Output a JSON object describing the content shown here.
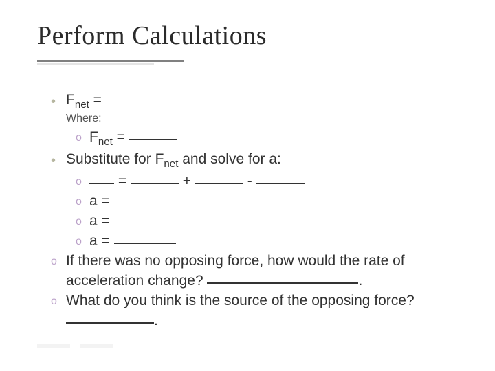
{
  "title": "Perform Calculations",
  "b1": {
    "fvar": "F",
    "fsub": "net",
    "eq": " = "
  },
  "where": "Where:",
  "s1": {
    "fvar": "F",
    "fsub": "net",
    "eq": " = "
  },
  "b2": {
    "pre": "Substitute for ",
    "fvar": "F",
    "fsub": "net",
    "post": " and solve for a:"
  },
  "s2eq": " = ",
  "s2plus": " + ",
  "s2minus": " - ",
  "s3": "a =",
  "s4": "a =",
  "s5": "a = ",
  "q1a": "If there was no opposing force, how would the rate of acceleration change? ",
  "q1b": ".",
  "q2a": "What do you think is the source of the opposing force? ",
  "q2b": "."
}
